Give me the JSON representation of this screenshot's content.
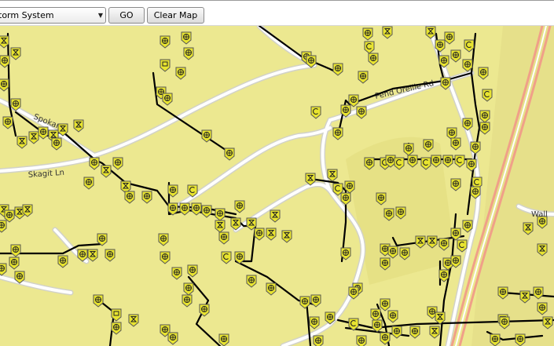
{
  "toolbar": {
    "layer_select_value": "torm System",
    "go_label": "GO",
    "clear_label": "Clear Map"
  },
  "map": {
    "road_labels": [
      "Spokane",
      "Skagit Ln",
      "Pend Oreille Rd",
      "Wall"
    ],
    "colors": {
      "land": "#ece890",
      "road_fill": "#ffffff",
      "road_casing": "#d2d2c8",
      "highway": "#f0a088",
      "pipe": "#000000",
      "marker_fill": "#e8e430",
      "marker_stroke": "#555555"
    },
    "marker_types": [
      "manhole-icon",
      "catch-basin-icon",
      "cleanout-icon",
      "outfall-icon"
    ]
  }
}
